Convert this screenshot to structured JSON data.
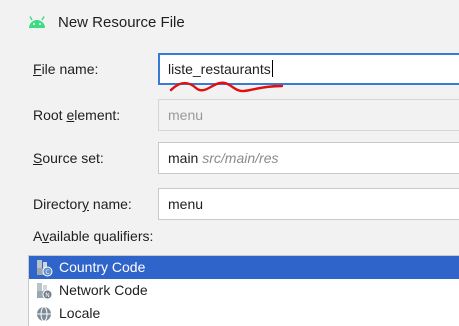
{
  "window": {
    "title": "New Resource File"
  },
  "form": {
    "file_name": {
      "label_before": "",
      "label_mnemonic": "F",
      "label_after": "ile name:",
      "value": "liste_restaurants"
    },
    "root_element": {
      "label_before": "Root ",
      "label_mnemonic": "e",
      "label_after": "lement:",
      "value": "menu"
    },
    "source_set": {
      "label_before": "",
      "label_mnemonic": "S",
      "label_after": "ource set:",
      "value": "main",
      "path": "src/main/res"
    },
    "directory_name": {
      "label_before": "Director",
      "label_mnemonic": "y",
      "label_after": " name:",
      "value": "menu"
    }
  },
  "qualifiers": {
    "label_before": "A",
    "label_mnemonic": "v",
    "label_after": "ailable qualifiers:",
    "items": [
      {
        "label": "Country Code",
        "icon": "country-code-icon",
        "selected": true
      },
      {
        "label": "Network Code",
        "icon": "network-code-icon",
        "selected": false
      },
      {
        "label": "Locale",
        "icon": "locale-icon",
        "selected": false
      }
    ]
  },
  "colors": {
    "accent": "#3b79d6",
    "selection": "#2f65ca",
    "annotation": "#e01010",
    "android": "#3ddc84"
  }
}
